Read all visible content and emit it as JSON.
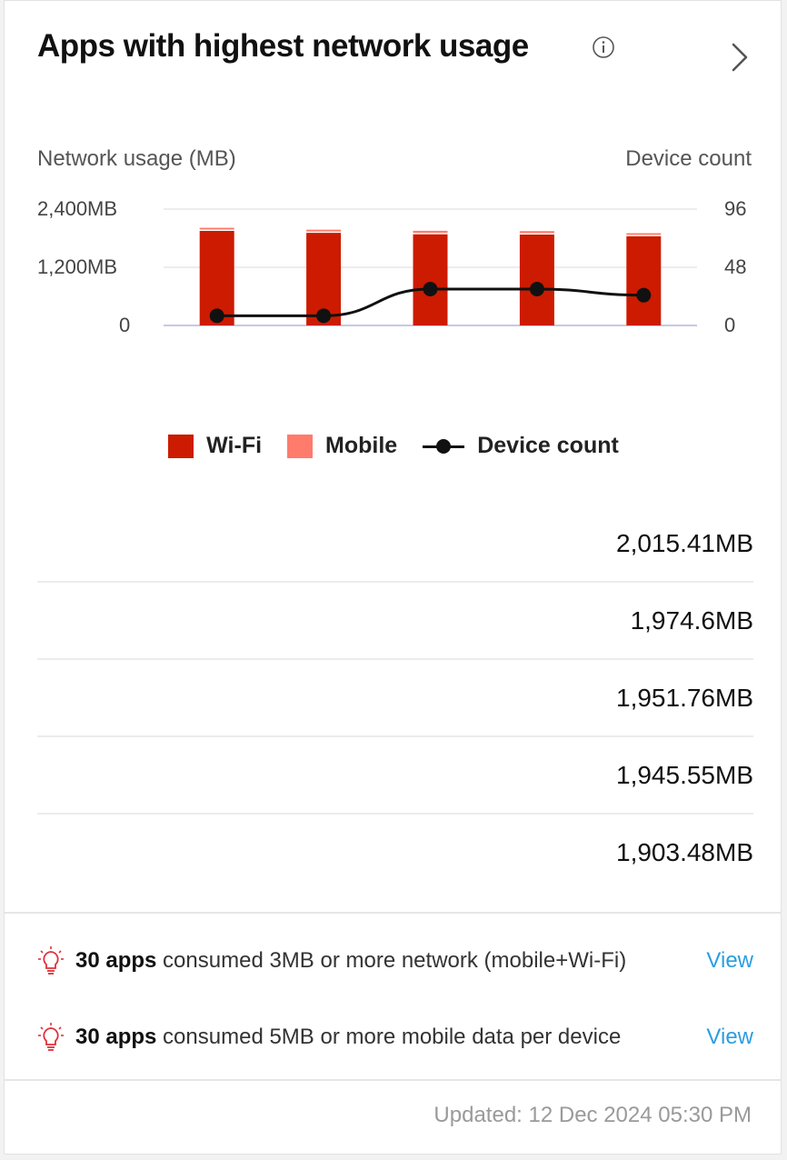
{
  "card": {
    "title": "Apps with highest network usage",
    "info_icon": "info-icon",
    "open_icon": "chevron-right-icon"
  },
  "chart_data": {
    "type": "bar",
    "y_title_left": "Network usage (MB)",
    "y_title_right": "Device count",
    "yleft_ticks": [
      "2,400MB",
      "1,200MB",
      "0"
    ],
    "yright_ticks": [
      "96",
      "48",
      "0"
    ],
    "ylim_left": [
      0,
      2400
    ],
    "ylim_right": [
      0,
      96
    ],
    "categories": [
      "",
      "",
      "",
      "",
      ""
    ],
    "series": [
      {
        "name": "Wi-Fi",
        "type": "bar",
        "values": [
          1950,
          1910,
          1880,
          1875,
          1840
        ],
        "color": "#cc1b00"
      },
      {
        "name": "Mobile",
        "type": "bar",
        "values": [
          65,
          65,
          72,
          71,
          63
        ],
        "color": "#ff7b6b"
      },
      {
        "name": "Device count",
        "type": "line",
        "values": [
          8,
          8,
          30,
          30,
          25
        ],
        "color": "#111111"
      }
    ],
    "grid": true,
    "legend_position": "bottom"
  },
  "legend": {
    "wifi": "Wi-Fi",
    "mobile": "Mobile",
    "devices": "Device count"
  },
  "apps": [
    {
      "name": "",
      "value": "2,015.41MB"
    },
    {
      "name": "",
      "value": "1,974.6MB"
    },
    {
      "name": "",
      "value": "1,951.76MB"
    },
    {
      "name": "",
      "value": "1,945.55MB"
    },
    {
      "name": "",
      "value": "1,903.48MB"
    }
  ],
  "insights": [
    {
      "count": "30 apps",
      "text": " consumed 3MB or more network (mobile+Wi-Fi)",
      "action": "View",
      "icon": "lightbulb-icon"
    },
    {
      "count": "30 apps",
      "text": " consumed 5MB or more mobile data per device",
      "action": "View",
      "icon": "lightbulb-icon"
    }
  ],
  "updated": "Updated: 12 Dec 2024 05:30 PM",
  "colors": {
    "wifi": "#cc1b00",
    "mobile": "#ff7b6b",
    "link": "#2a9ee0",
    "bulb": "#e0303a"
  }
}
